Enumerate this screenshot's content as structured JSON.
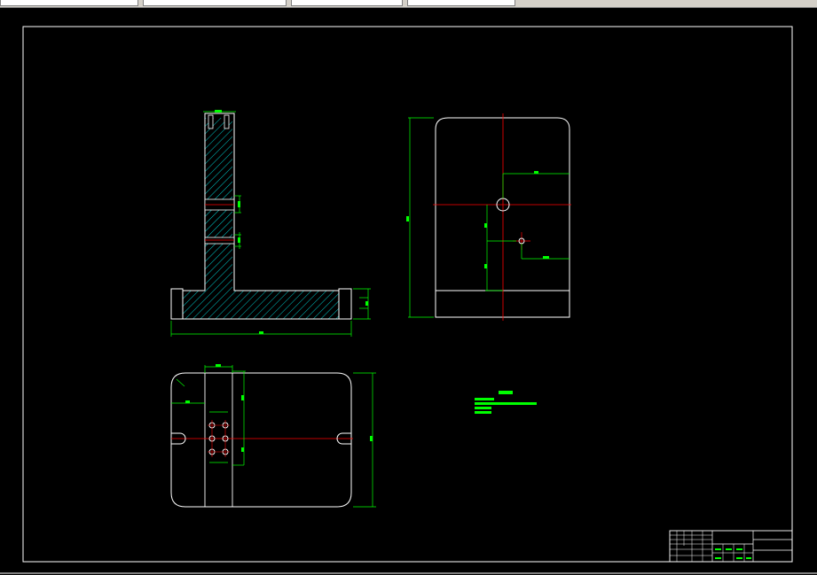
{
  "tabs": [
    {
      "label": ""
    },
    {
      "label": ""
    },
    {
      "label": ""
    },
    {
      "label": ""
    }
  ],
  "colors": {
    "background": "#000000",
    "outline": "#ffffff",
    "dimension": "#00ff00",
    "centerline": "#ff0000",
    "section_hatch": "#00ffff",
    "annotation_fill": "#00ff00",
    "title_block": "#ffffff",
    "title_block_text": "#00ff00"
  },
  "views": {
    "front_section": "front-section-view",
    "side_view": "side-view",
    "top_view": "top-view"
  },
  "technical_requirements": {
    "heading": "",
    "lines": [
      "",
      "",
      ""
    ]
  },
  "title_block": {
    "cells": []
  }
}
